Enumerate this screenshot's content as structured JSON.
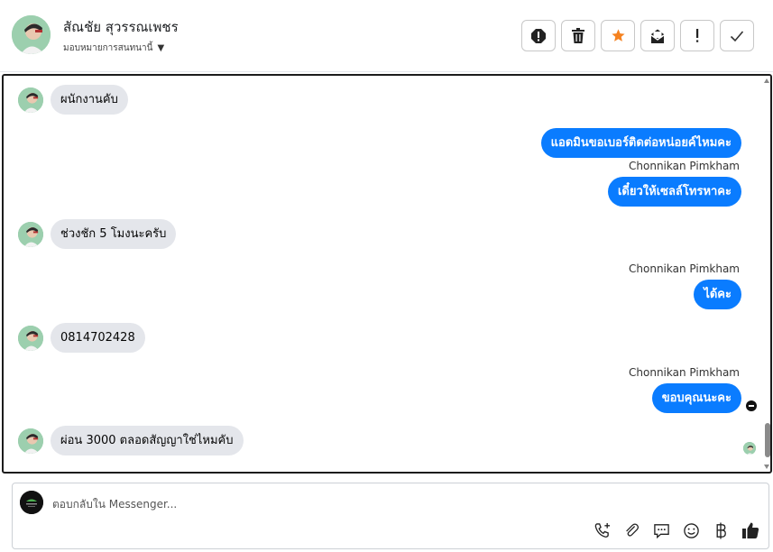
{
  "header": {
    "contact_name": "สัณชัย สุวรรณเพชร",
    "assign_label": "มอบหมายการสนทนานี้",
    "actions": [
      {
        "name": "report-icon",
        "label": "Report"
      },
      {
        "name": "trash-icon",
        "label": "Delete"
      },
      {
        "name": "star-icon",
        "label": "Star"
      },
      {
        "name": "mail-icon",
        "label": "Mark unread"
      },
      {
        "name": "exclamation-icon",
        "label": "Important"
      },
      {
        "name": "check-icon",
        "label": "Done"
      }
    ]
  },
  "messages": {
    "m1": "ผนักงานคับ",
    "m2": "แอดมินขอเบอร์ติดต่อหน่อยค์ไหมคะ",
    "m3_sender": "Chonnikan Pimkham",
    "m3": "เดี๋ยวให้เซลล์โทรหาคะ",
    "m4": "ช่วงชัก 5 โมงนะครับ",
    "m5_sender": "Chonnikan Pimkham",
    "m5": "ได้คะ",
    "m6": "0814702428",
    "m7_sender": "Chonnikan Pimkham",
    "m7": "ขอบคุณนะคะ",
    "m8": "ผ่อน 3000 ตลอดสัญญาใช่ไหมคับ"
  },
  "composer": {
    "placeholder": "ตอบกลับใน Messenger..."
  },
  "colors": {
    "outgoing_bubble": "#0a7cff",
    "incoming_bubble": "#e4e6eb",
    "star": "#f58220"
  }
}
